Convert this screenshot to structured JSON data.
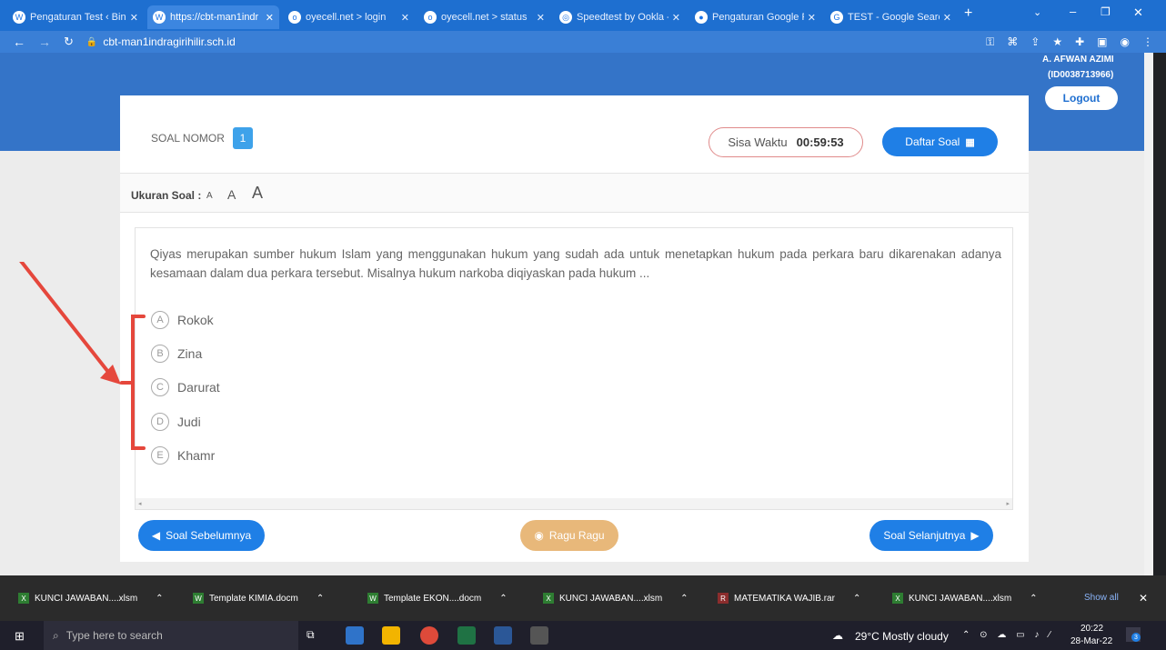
{
  "browser": {
    "tabs": [
      {
        "label": "Pengaturan Test ‹ Bin"
      },
      {
        "label": "https://cbt-man1indr"
      },
      {
        "label": "oyecell.net > login"
      },
      {
        "label": "oyecell.net > status"
      },
      {
        "label": "Speedtest by Ookla -"
      },
      {
        "label": "Pengaturan Google F"
      },
      {
        "label": "TEST - Google Search"
      }
    ],
    "url": "cbt-man1indragirihilir.sch.id"
  },
  "header": {
    "user_name": "A. AFWAN AZIMI",
    "user_id": "(ID0038713966)",
    "logout_label": "Logout"
  },
  "exam": {
    "question_label": "SOAL NOMOR",
    "question_number": "1",
    "timer_label": "Sisa Waktu",
    "timer_value": "00:59:53",
    "list_button": "Daftar Soal",
    "size_label": "Ukuran Soal :",
    "size_small": "A",
    "size_medium": "A",
    "size_large": "A",
    "question_text": "Qiyas merupakan sumber hukum Islam yang menggunakan hukum yang sudah ada untuk menetapkan hukum pada perkara baru dikarenakan adanya kesamaan dalam dua perkara tersebut. Misalnya hukum narkoba diqiyaskan pada hukum ...",
    "options": [
      {
        "letter": "A",
        "text": "Rokok"
      },
      {
        "letter": "B",
        "text": "Zina"
      },
      {
        "letter": "C",
        "text": "Darurat"
      },
      {
        "letter": "D",
        "text": "Judi"
      },
      {
        "letter": "E",
        "text": "Khamr"
      }
    ],
    "prev_button": "Soal Sebelumnya",
    "doubt_button": "Ragu Ragu",
    "next_button": "Soal Selanjutnya"
  },
  "downloads": {
    "items": [
      {
        "label": "KUNCI JAWABAN....xlsm"
      },
      {
        "label": "Template KIMIA.docm"
      },
      {
        "label": "Template EKON....docm"
      },
      {
        "label": "KUNCI JAWABAN....xlsm"
      },
      {
        "label": "MATEMATIKA WAJIB.rar"
      },
      {
        "label": "KUNCI JAWABAN....xlsm"
      }
    ],
    "show_all": "Show all"
  },
  "taskbar": {
    "search_placeholder": "Type here to search",
    "weather": "29°C  Mostly cloudy",
    "time": "20:22",
    "date": "28-Mar-22",
    "notifications": "3"
  },
  "colors": {
    "accent": "#1f7fe6",
    "annotation": "#e5473c",
    "doubt": "#e8b87a"
  }
}
